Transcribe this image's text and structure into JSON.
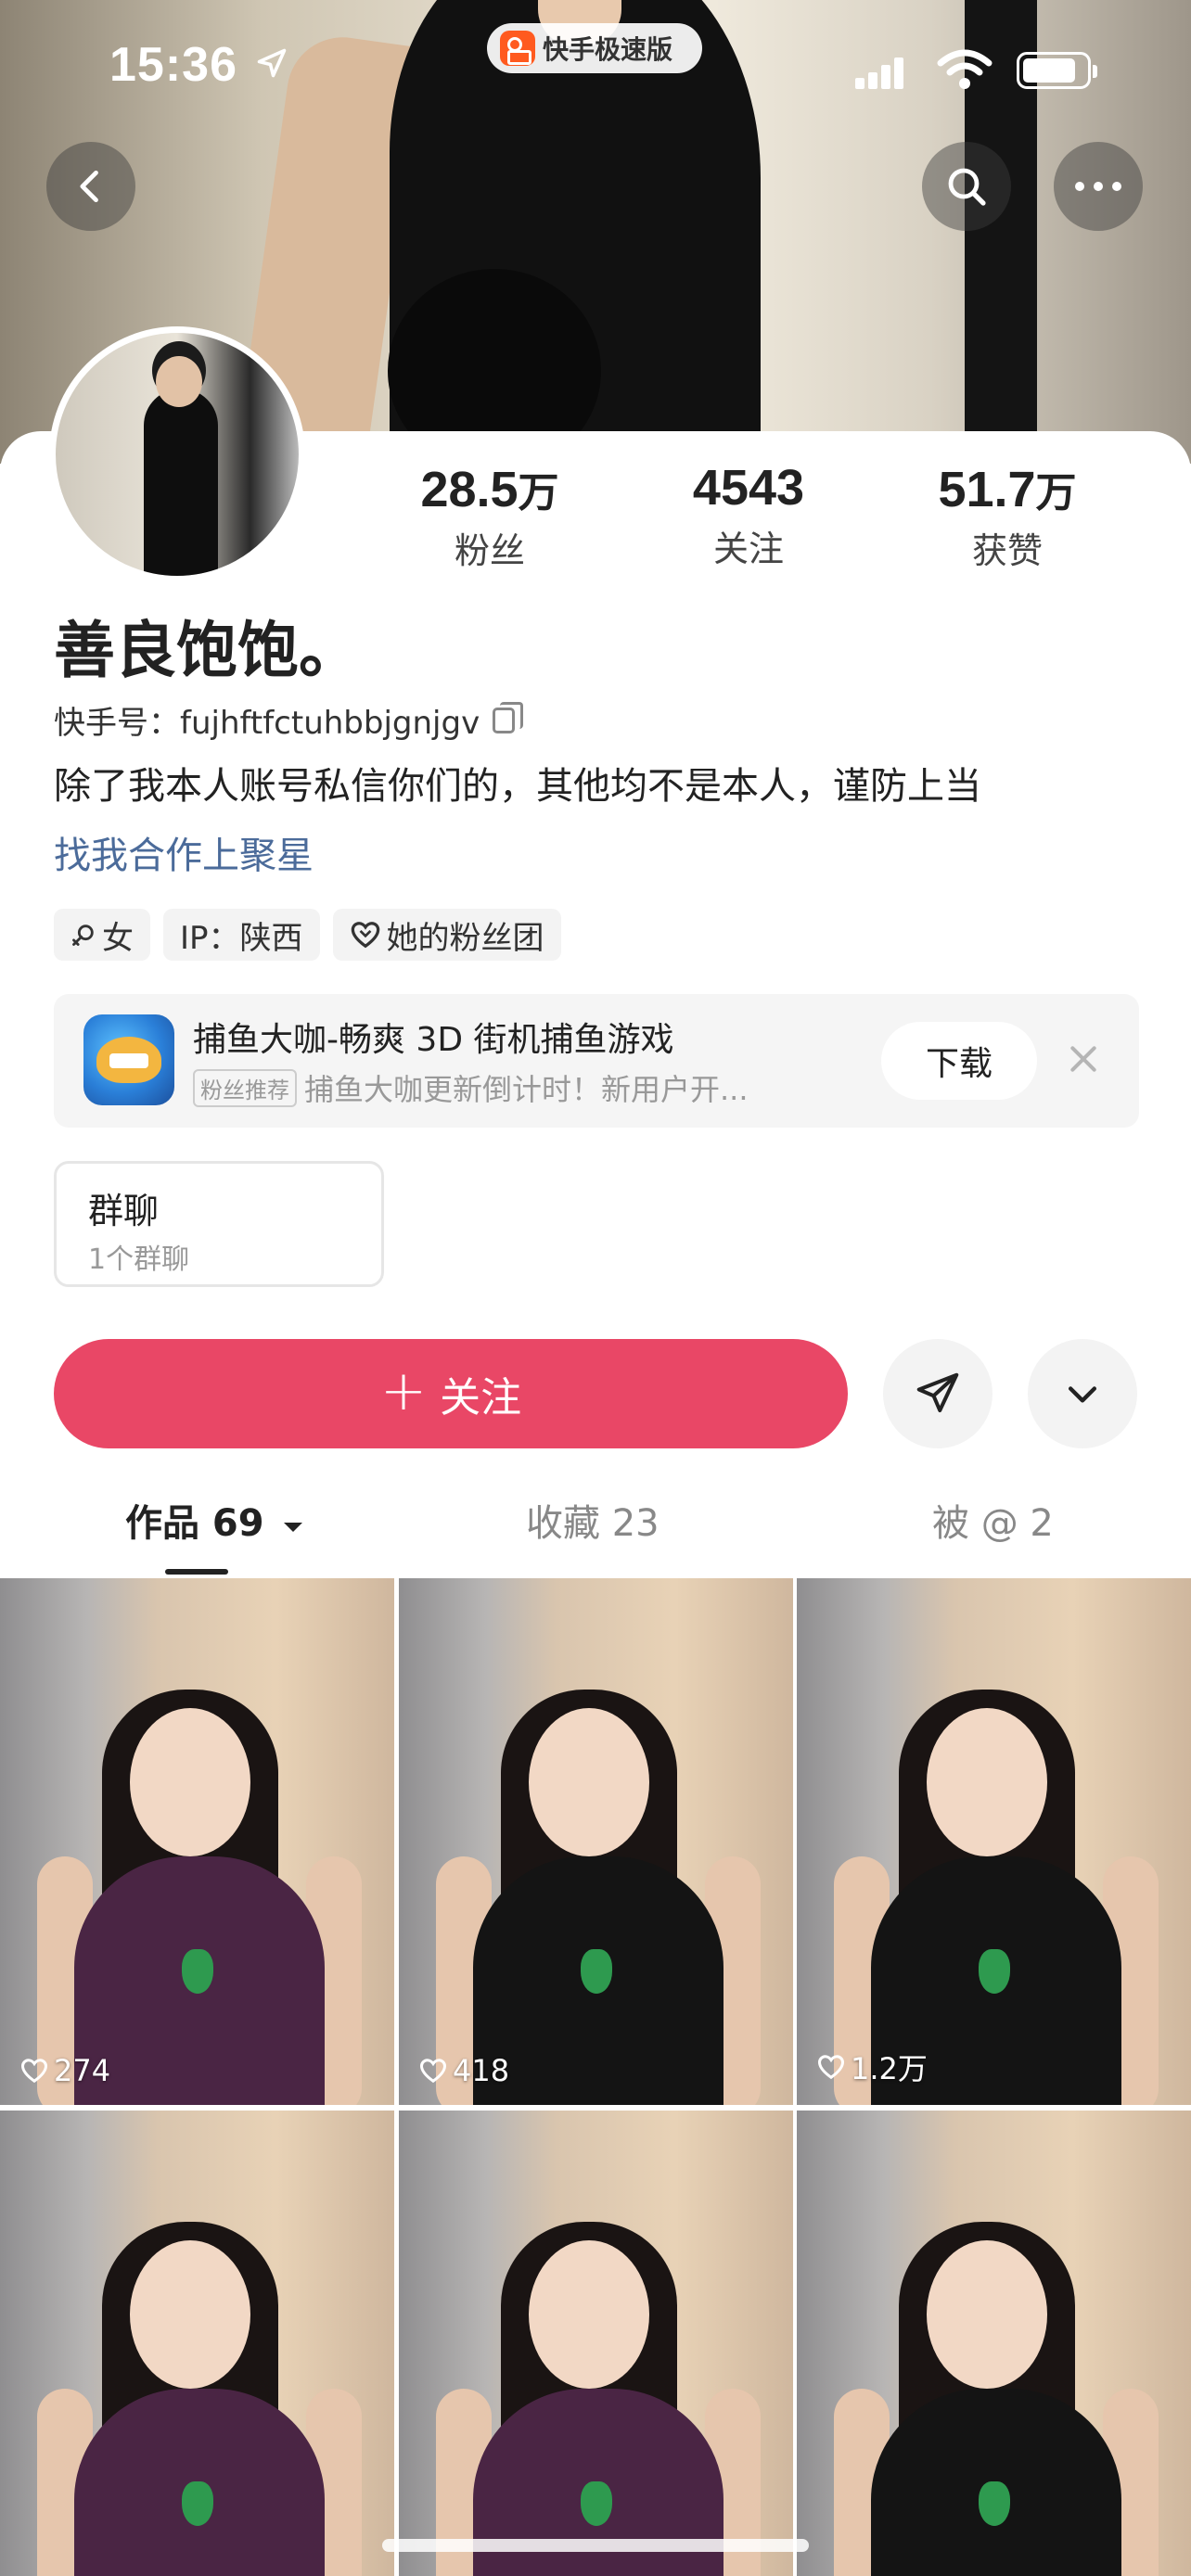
{
  "status_bar": {
    "time": "15:36",
    "app_pill": "快手极速版"
  },
  "profile": {
    "stats": [
      {
        "value": "28.5",
        "unit": "万",
        "label": "粉丝"
      },
      {
        "value": "4543",
        "unit": "",
        "label": "关注"
      },
      {
        "value": "51.7",
        "unit": "万",
        "label": "获赞"
      }
    ],
    "name": "善良饱饱。",
    "kuaishou_id_label": "快手号：",
    "kuaishou_id": "fujhftfctuhbbjgnjgv",
    "bio": "除了我本人账号私信你们的，其他均不是本人，谨防上当",
    "bio_link": "找我合作上聚星",
    "tags": [
      {
        "icon": "gender-female-icon",
        "label": "女"
      },
      {
        "icon": "",
        "label": "IP：陕西"
      },
      {
        "icon": "heart-outline-icon",
        "label": "她的粉丝团"
      }
    ]
  },
  "ad": {
    "title": "捕鱼大咖-畅爽 3D 街机捕鱼游戏",
    "badge": "粉丝推荐",
    "description": "捕鱼大咖更新倒计时！新用户开...",
    "download_label": "下载"
  },
  "group_chat": {
    "title": "群聊",
    "subtitle": "1个群聊"
  },
  "actions": {
    "follow_label": "关注"
  },
  "tabs": [
    {
      "label": "作品 69",
      "active": true
    },
    {
      "label": "收藏 23",
      "active": false
    },
    {
      "label": "被 @ 2",
      "active": false
    }
  ],
  "videos": [
    {
      "likes": "274",
      "top_color": "#4a2544"
    },
    {
      "likes": "418",
      "top_color": "#141414"
    },
    {
      "likes": "1.2万",
      "top_color": "#141414"
    },
    {
      "likes": "",
      "top_color": "#4a2544"
    },
    {
      "likes": "",
      "top_color": "#4a2544"
    },
    {
      "likes": "",
      "top_color": "#141414"
    }
  ],
  "colors": {
    "accent": "#e94766",
    "link": "#4b6b9a"
  }
}
